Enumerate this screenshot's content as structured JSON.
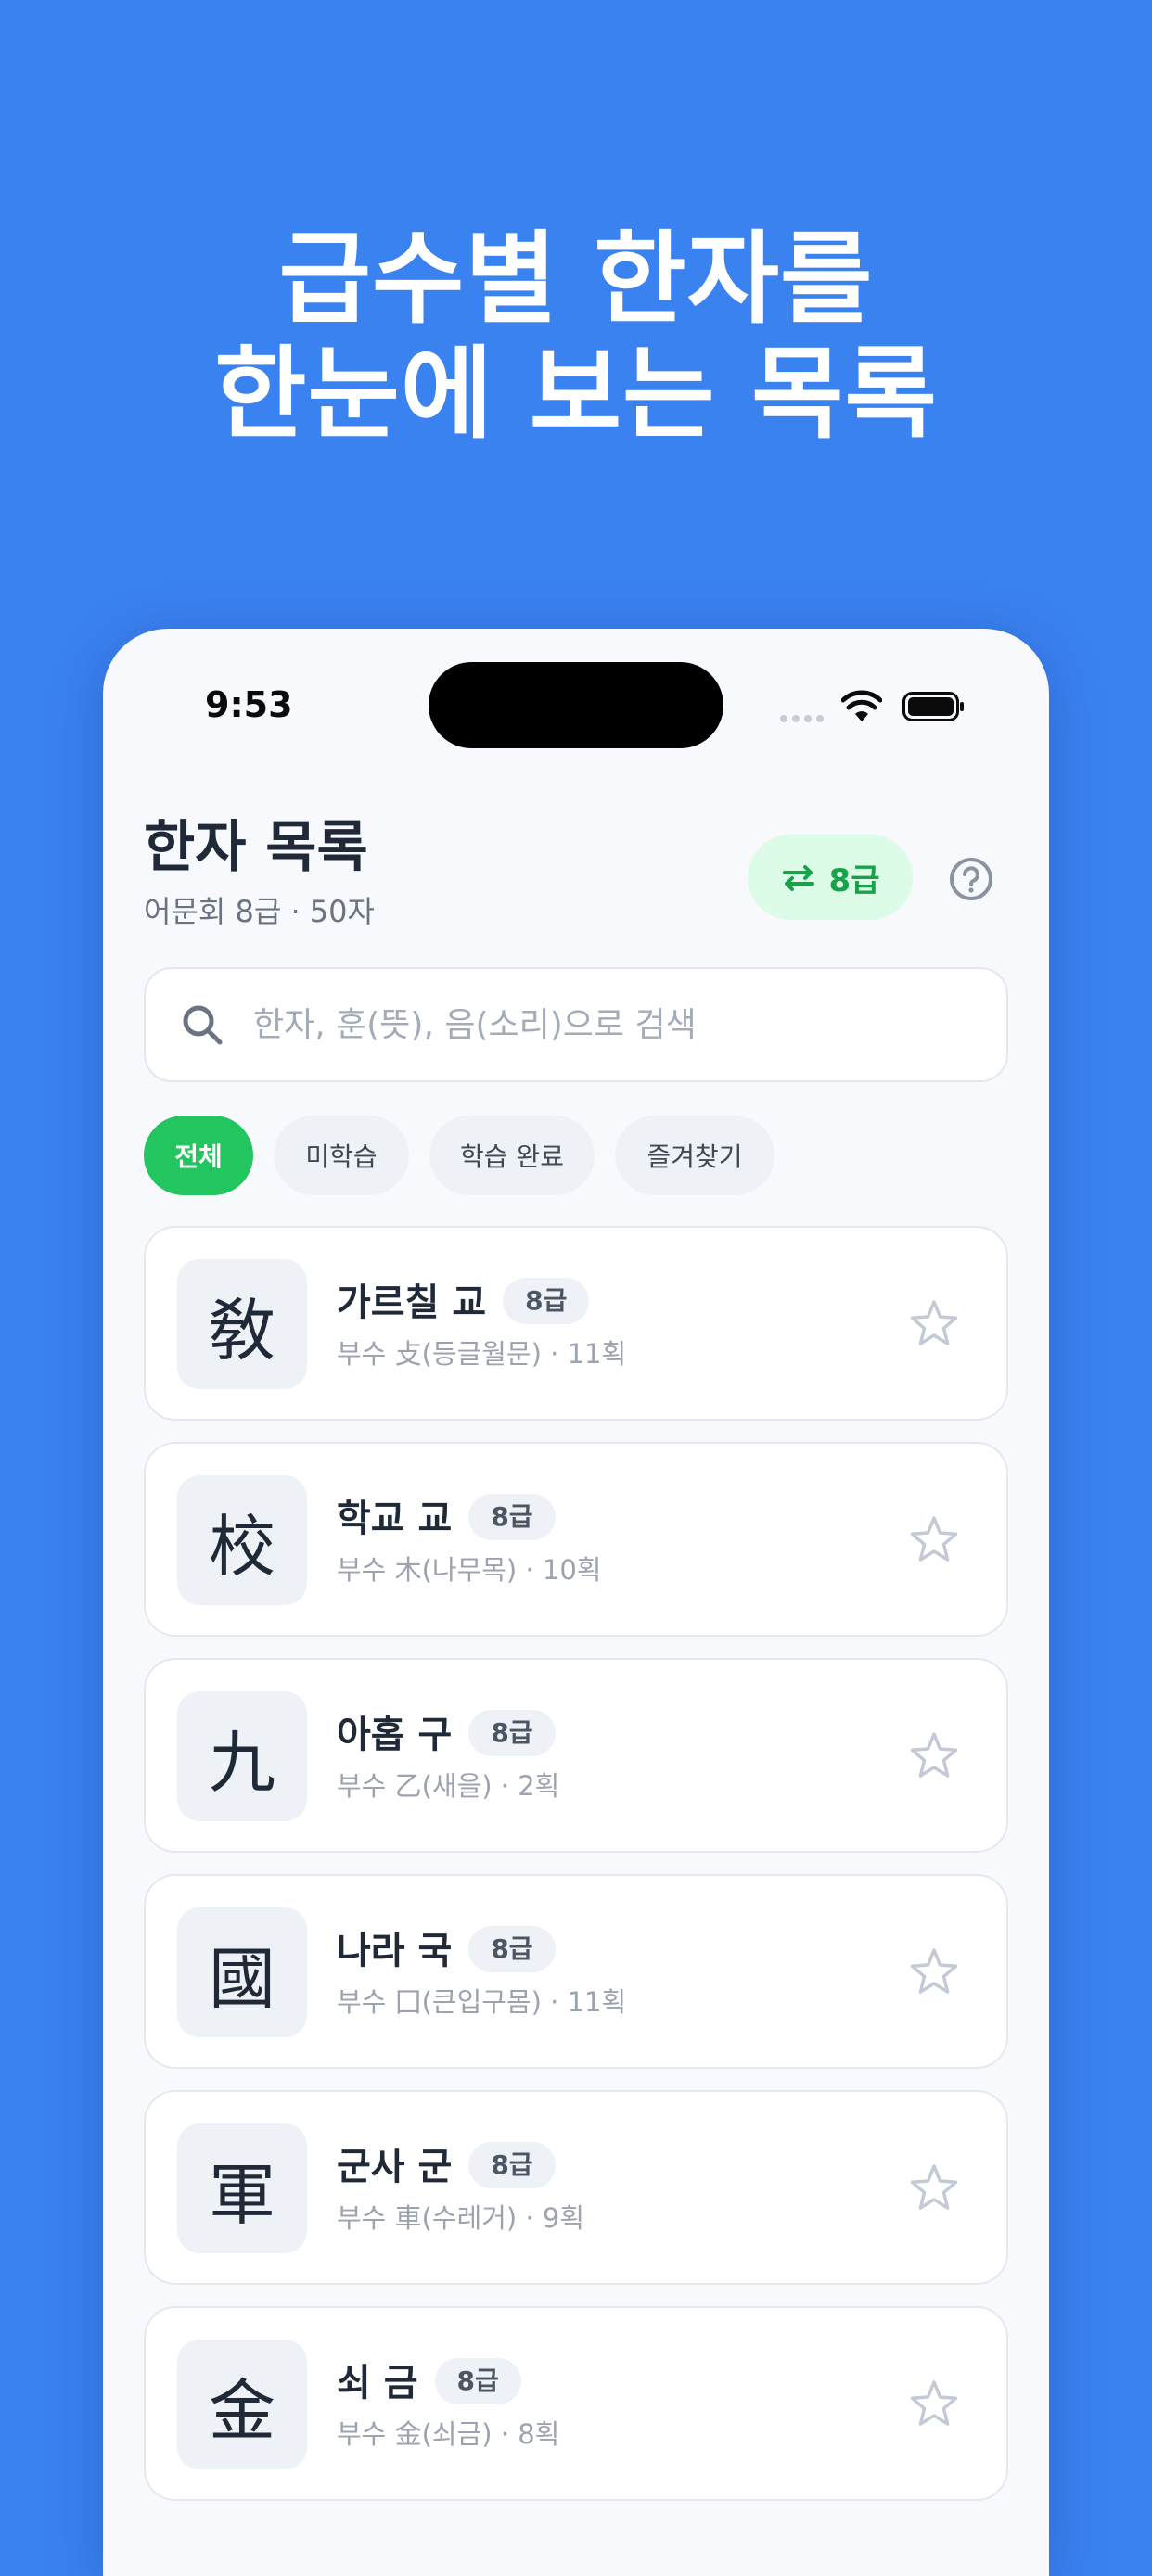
{
  "headline": {
    "line1": "급수별 한자를",
    "line2": "한눈에 보는 목록"
  },
  "status_bar": {
    "time": "9:53",
    "icons": [
      "signal-dots-icon",
      "wifi-icon",
      "battery-icon"
    ]
  },
  "header": {
    "title": "한자 목록",
    "subtitle": "어문회 8급 · 50자",
    "grade_button_label": "8급",
    "grade_button_icon": "swap-arrows-icon",
    "help_icon": "question-circle-icon"
  },
  "search": {
    "placeholder": "한자, 훈(뜻), 음(소리)으로 검색",
    "value": ""
  },
  "filters": {
    "items": [
      {
        "label": "전체",
        "active": true
      },
      {
        "label": "미학습",
        "active": false
      },
      {
        "label": "학습 완료",
        "active": false
      },
      {
        "label": "즐겨찾기",
        "active": false
      }
    ]
  },
  "list": {
    "items": [
      {
        "hanja": "敎",
        "meaning": "가르칠 교",
        "grade": "8급",
        "detail": "부수 攴(등글월문) · 11획"
      },
      {
        "hanja": "校",
        "meaning": "학교 교",
        "grade": "8급",
        "detail": "부수 木(나무목) · 10획"
      },
      {
        "hanja": "九",
        "meaning": "아홉 구",
        "grade": "8급",
        "detail": "부수 乙(새을) · 2획"
      },
      {
        "hanja": "國",
        "meaning": "나라 국",
        "grade": "8급",
        "detail": "부수 囗(큰입구몸) · 11획"
      },
      {
        "hanja": "軍",
        "meaning": "군사 군",
        "grade": "8급",
        "detail": "부수 車(수레거) · 9획"
      },
      {
        "hanja": "金",
        "meaning": "쇠 금",
        "grade": "8급",
        "detail": "부수 金(쇠금) · 8획"
      }
    ]
  },
  "colors": {
    "background": "#3b82f1",
    "accent_green": "#22c55e",
    "text_dark": "#1f2937",
    "text_muted": "#9ca3af"
  }
}
